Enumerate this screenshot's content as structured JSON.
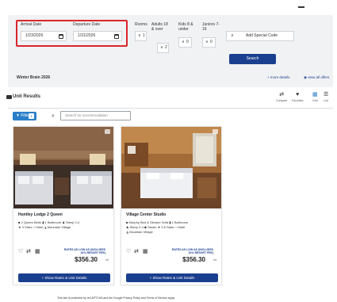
{
  "search": {
    "arrival_label": "Arrival Date",
    "arrival_value": "1/23/2026",
    "departure_label": "Departure Date",
    "departure_value": "1/31/2026",
    "rooms_label": "Rooms",
    "rooms_value": "1",
    "adults_label": "Adults 18 & over",
    "adults_value": "2",
    "kids_label": "Kids 8 & under",
    "kids_value": "0",
    "juniors_label": "Juniors 7-16",
    "juniors_value": "0",
    "special_code_placeholder": "Add Special Code",
    "search_button": "Search",
    "offer_title": "Winter Brain 2026",
    "more_details": "+ more details",
    "view_all_offers": "view all offers"
  },
  "results": {
    "title": "Unit Results",
    "tools": [
      {
        "label": "Compare",
        "icon": "compare-icon",
        "glyph": "⇄"
      },
      {
        "label": "Favorites",
        "icon": "heart-icon",
        "glyph": "♥"
      },
      {
        "label": "Grid",
        "icon": "grid-icon",
        "glyph": "▦"
      },
      {
        "label": "List",
        "icon": "list-icon",
        "glyph": "☰"
      }
    ],
    "filter_label": "Filter",
    "filter_count": "1",
    "search_placeholder": "Search for accommodation"
  },
  "cards": [
    {
      "name": "Huntley Lodge 2 Queen",
      "amenities_line1": "■ 2 Queen Beds  ▮ 1 Bathroom  ♟ Sleep 2-4",
      "amenities_line2": "★ 3 Stars  ⌂ Hotel  ◮ Mountain Village",
      "amenities_line3": "",
      "rates_note": "RATES AS LOW AS (INCLUDES 10% RESORT FEE)",
      "price": "$356.30",
      "per_night": "/nt",
      "button": "+ Show Rates & Unit Details"
    },
    {
      "name": "Village Center Studio",
      "amenities_line1": "■ Murphy Bed & Sleeper Sofa  ▮ 1 Bathroom",
      "amenities_line2": "♟ Sleep 2-4  ◆ Studio  ★ 3.5 Stars  ⌂ Hotel",
      "amenities_line3": "◮ Mountain Village",
      "rates_note": "RATES AS LOW AS (INCLUDES 10% RESORT FEE)",
      "price": "$356.30",
      "per_night": "/nt",
      "button": "+ Show Rates & Unit Details"
    }
  ],
  "footer": "This site is protected by reCAPTCHA and the Google Privacy Policy and Terms of Service apply."
}
